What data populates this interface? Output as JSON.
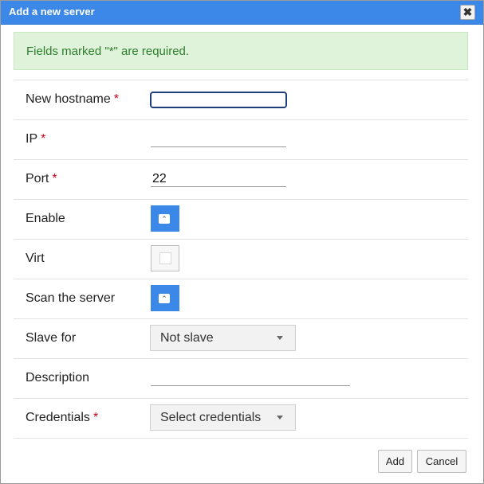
{
  "dialog": {
    "title": "Add a new server",
    "close_symbol": "✖",
    "notice": "Fields marked \"*\" are required."
  },
  "form": {
    "required_marker": "*",
    "hostname": {
      "label": "New hostname",
      "value": ""
    },
    "ip": {
      "label": "IP",
      "value": ""
    },
    "port": {
      "label": "Port",
      "value": "22"
    },
    "enable": {
      "label": "Enable",
      "checked": true,
      "icon": "chevron-up-icon"
    },
    "virt": {
      "label": "Virt",
      "checked": false
    },
    "scan": {
      "label": "Scan the server",
      "checked": true,
      "icon": "chevron-up-icon"
    },
    "slave_for": {
      "label": "Slave for",
      "value": "Not slave"
    },
    "description": {
      "label": "Description",
      "value": ""
    },
    "credentials": {
      "label": "Credentials",
      "value": "Select credentials"
    }
  },
  "footer": {
    "add_label": "Add",
    "cancel_label": "Cancel"
  },
  "colors": {
    "titlebar": "#3c88e8",
    "notice_bg": "#dff3da",
    "notice_text": "#2d7d2d",
    "required": "#d0021b"
  }
}
